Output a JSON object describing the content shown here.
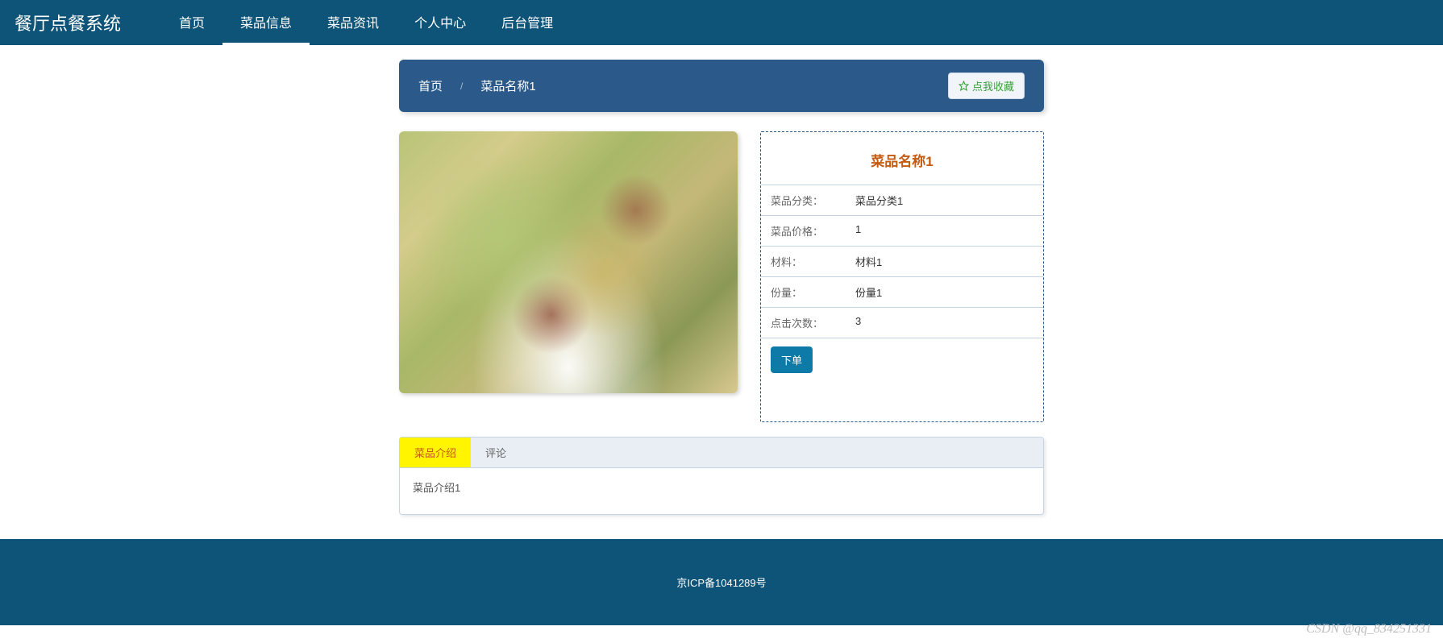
{
  "header": {
    "logo": "餐厅点餐系统",
    "nav": [
      {
        "label": "首页",
        "active": false
      },
      {
        "label": "菜品信息",
        "active": true
      },
      {
        "label": "菜品资讯",
        "active": false
      },
      {
        "label": "个人中心",
        "active": false
      },
      {
        "label": "后台管理",
        "active": false
      }
    ]
  },
  "breadcrumb": {
    "home": "首页",
    "separator": "/",
    "current": "菜品名称1"
  },
  "favorite_button": "点我收藏",
  "product": {
    "title": "菜品名称1",
    "fields": [
      {
        "label": "菜品分类：",
        "value": "菜品分类1"
      },
      {
        "label": "菜品价格：",
        "value": "1"
      },
      {
        "label": "材料：",
        "value": "材料1"
      },
      {
        "label": "份量：",
        "value": "份量1"
      },
      {
        "label": "点击次数：",
        "value": "3"
      }
    ],
    "order_button": "下单"
  },
  "tabs": {
    "items": [
      {
        "label": "菜品介绍",
        "active": true
      },
      {
        "label": "评论",
        "active": false
      }
    ],
    "content": "菜品介绍1"
  },
  "footer": {
    "icp": "京ICP备1041289号"
  },
  "watermark": "CSDN @qq_834251331"
}
